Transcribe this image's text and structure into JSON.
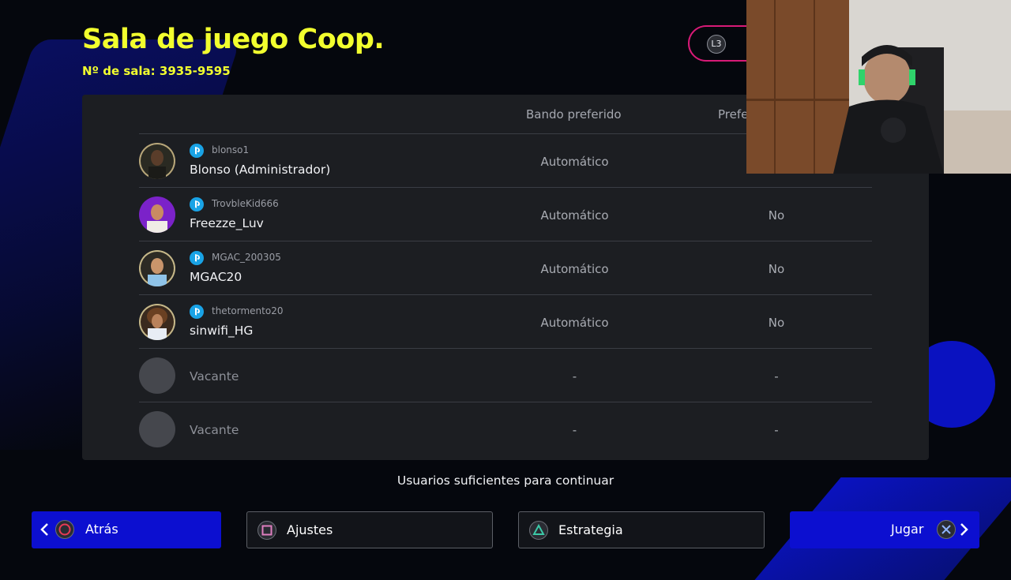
{
  "header": {
    "title": "Sala de juego Coop.",
    "room_number": "Nº de sala: 3935-9595",
    "l3_badge": "L3"
  },
  "table": {
    "columns": [
      "Bando preferido",
      "Prefe"
    ],
    "rows": [
      {
        "psn_id": "blonso1",
        "name": "Blonso (Administrador)",
        "bando": "Automático",
        "pref": "",
        "avatar": "player-photo-dark"
      },
      {
        "psn_id": "TrovbleKid666",
        "name": "Freezze_Luv",
        "bando": "Automático",
        "pref": "No",
        "avatar": "player-photo-purple"
      },
      {
        "psn_id": "MGAC_200305",
        "name": "MGAC20",
        "bando": "Automático",
        "pref": "No",
        "avatar": "player-photo-messi"
      },
      {
        "psn_id": "thetormento20",
        "name": "sinwifi_HG",
        "bando": "Automático",
        "pref": "No",
        "avatar": "player-photo-valderrama"
      },
      {
        "psn_id": "",
        "name": "Vacante",
        "bando": "-",
        "pref": "-",
        "avatar": "empty"
      },
      {
        "psn_id": "",
        "name": "Vacante",
        "bando": "-",
        "pref": "-",
        "avatar": "empty"
      }
    ]
  },
  "status_text": "Usuarios suficientes para continuar",
  "buttons": {
    "back": "Atrás",
    "settings": "Ajustes",
    "strategy": "Estrategia",
    "play": "Jugar"
  },
  "colors": {
    "title_yellow": "#f2ff2e",
    "button_blue": "#0c0fd0",
    "l3_ring": "#d81a77",
    "psn_blue": "#19a3e6"
  }
}
